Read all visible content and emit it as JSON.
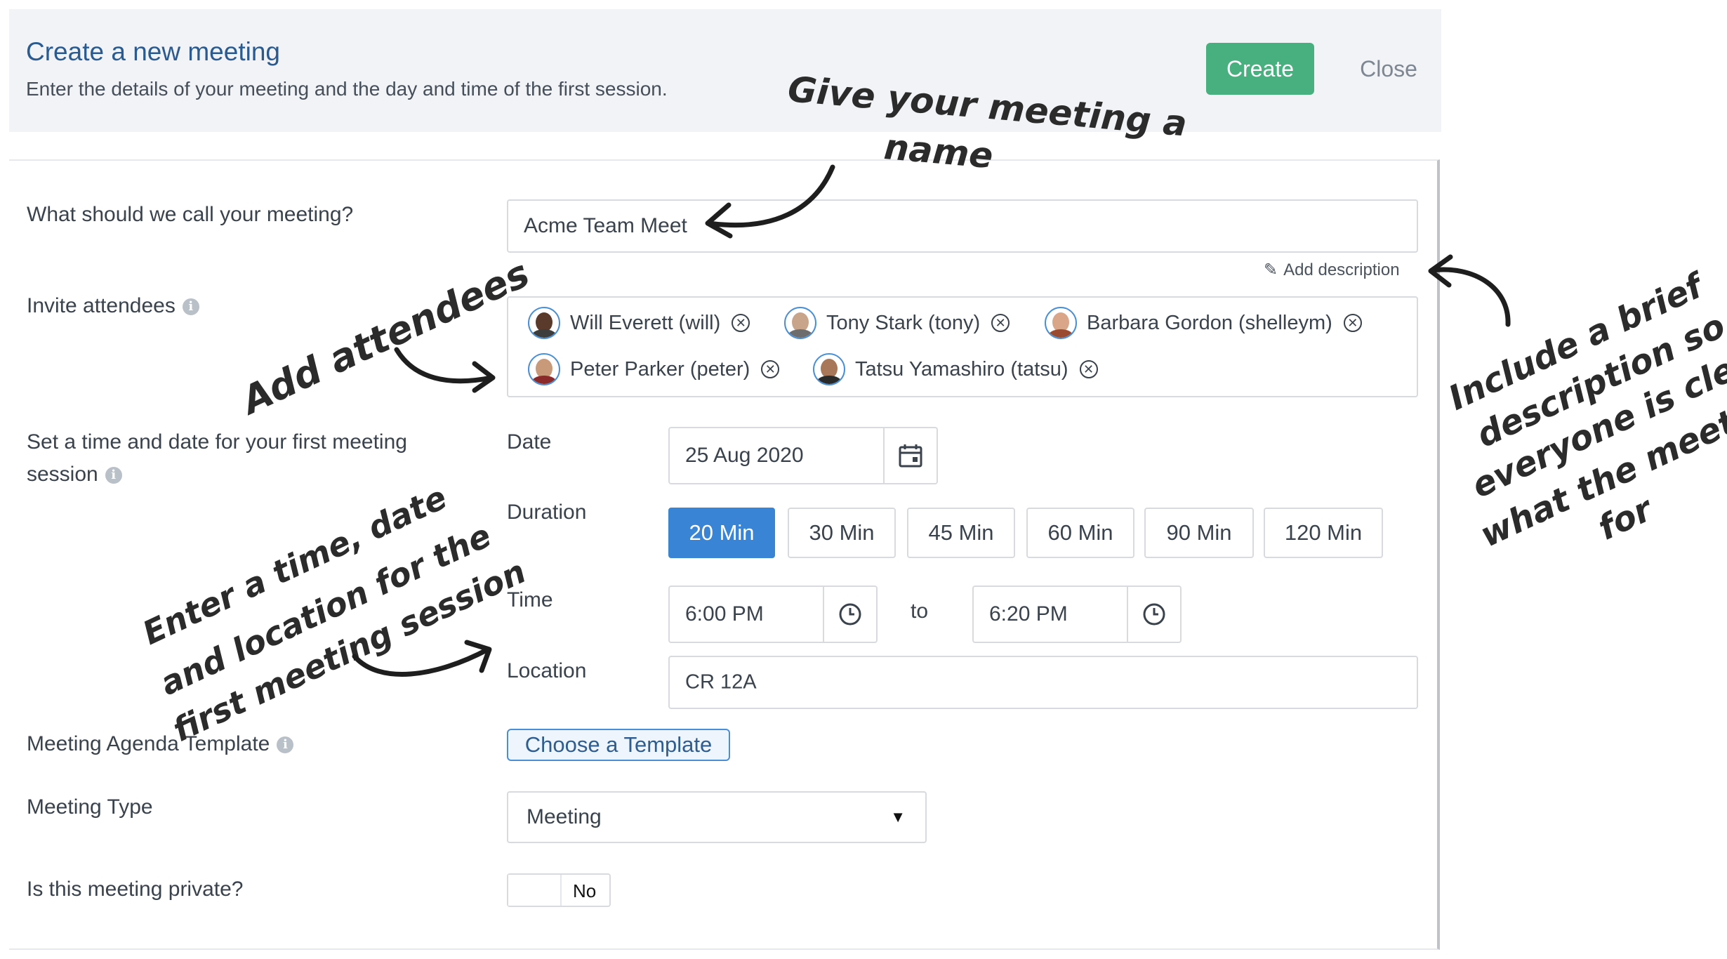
{
  "header": {
    "title": "Create a new meeting",
    "subtitle": "Enter the details of your meeting and the day and time of the first session.",
    "create_label": "Create",
    "close_label": "Close"
  },
  "form": {
    "name_label": "What should we call your meeting?",
    "name_value": "Acme Team Meet",
    "add_description": "Add description",
    "attendees_label": "Invite attendees",
    "attendees": [
      {
        "name": "Will Everett (will)"
      },
      {
        "name": "Tony Stark (tony)"
      },
      {
        "name": "Barbara Gordon (shelleym)"
      },
      {
        "name": "Peter Parker (peter)"
      },
      {
        "name": "Tatsu Yamashiro (tatsu)"
      }
    ],
    "session_label_1": "Set a time and date for your first meeting",
    "session_label_2": "session",
    "date_label": "Date",
    "date_value": "25 Aug 2020",
    "duration_label": "Duration",
    "durations": [
      "20 Min",
      "30 Min",
      "45 Min",
      "60 Min",
      "90 Min",
      "120 Min"
    ],
    "selected_duration": "20 Min",
    "time_label": "Time",
    "time_start": "6:00 PM",
    "time_to": "to",
    "time_end": "6:20 PM",
    "location_label": "Location",
    "location_value": "CR 12A",
    "agenda_label": "Meeting Agenda Template",
    "template_button": "Choose a Template",
    "type_label": "Meeting Type",
    "type_value": "Meeting",
    "private_label": "Is this meeting private?",
    "private_value": "No"
  },
  "annotations": {
    "name_note_1": "Give your meeting a",
    "name_note_2": "name",
    "attendees_note": "Add attendees",
    "session_note_1": "Enter a time, date",
    "session_note_2": "and location for the",
    "session_note_3": "first meeting session",
    "desc_note_1": "Include a brief",
    "desc_note_2": "description so",
    "desc_note_3": "everyone is clear",
    "desc_note_4": "what the meeting is",
    "desc_note_5": "for"
  },
  "colors": {
    "primary": "#3a84d6",
    "create": "#48b07f",
    "title": "#2a5a8f",
    "header_bg": "#f1f3f6"
  }
}
